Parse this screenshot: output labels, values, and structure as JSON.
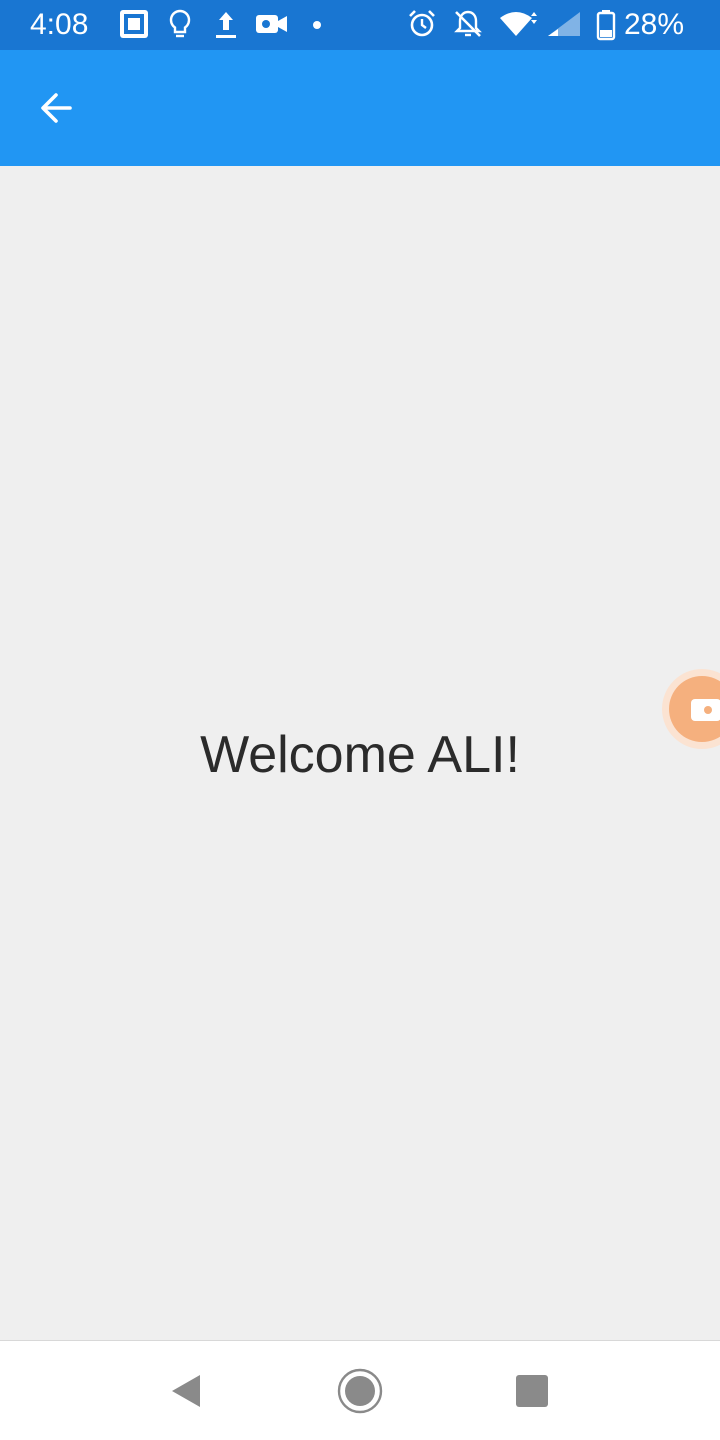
{
  "status_bar": {
    "time": "4:08",
    "battery_percent": "28%",
    "icons_left": [
      "screenshot-icon",
      "lightbulb-icon",
      "upload-icon",
      "video-camera-icon",
      "dot-icon"
    ],
    "icons_right": [
      "alarm-icon",
      "notifications-off-icon",
      "wifi-icon",
      "cell-signal-icon",
      "battery-icon"
    ]
  },
  "app_bar": {
    "back_icon": "arrow-back-icon",
    "color": "#2196f3"
  },
  "main": {
    "welcome_text": "Welcome ALI!"
  },
  "floating_button": {
    "icon": "video-camera-icon",
    "color": "#f5b07e"
  },
  "nav_bar": {
    "back_icon": "nav-back-icon",
    "home_icon": "nav-home-icon",
    "recents_icon": "nav-recents-icon"
  },
  "colors": {
    "status_bar": "#1976d2",
    "background": "#efefef",
    "text": "#2b2b2b"
  }
}
